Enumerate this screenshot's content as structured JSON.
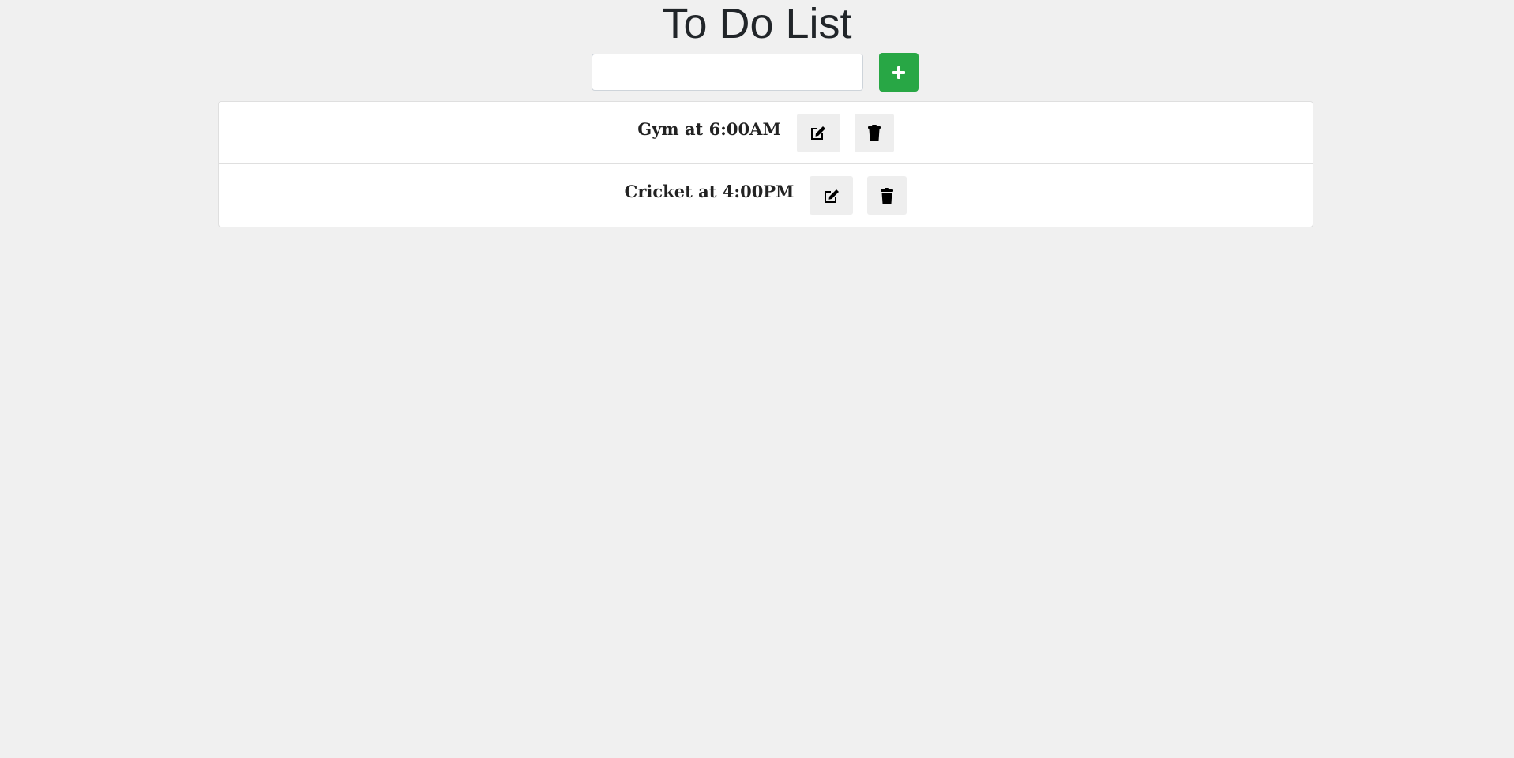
{
  "header": {
    "title": "To Do List"
  },
  "add_form": {
    "input_value": "",
    "input_placeholder": "",
    "add_icon": "plus-icon",
    "add_color": "#28a745"
  },
  "tasks": [
    {
      "label": "Gym at 6:00AM",
      "edit_icon": "edit-icon",
      "delete_icon": "trash-icon"
    },
    {
      "label": "Cricket at 4:00PM",
      "edit_icon": "edit-icon",
      "delete_icon": "trash-icon"
    }
  ]
}
